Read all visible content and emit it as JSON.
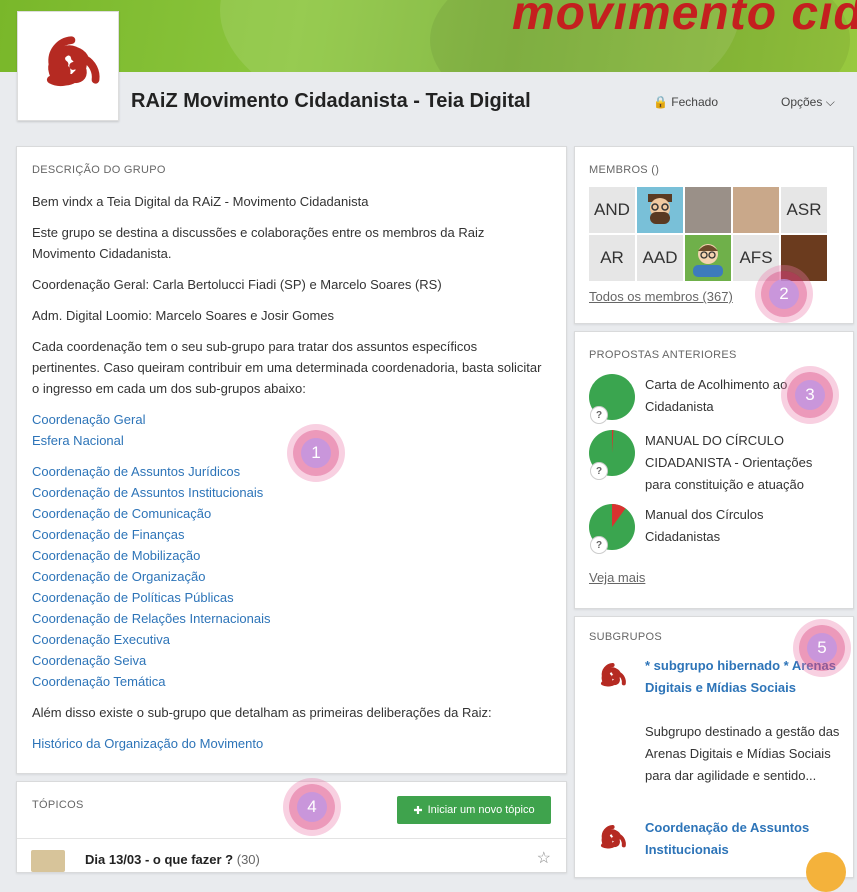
{
  "banner": {
    "text": "movimento cid"
  },
  "group": {
    "title": "RAiZ Movimento Cidadanista - Teia Digital",
    "privacy_label": "Fechado",
    "options_label": "Opções"
  },
  "description": {
    "label": "DESCRIÇÃO DO GRUPO",
    "paragraphs": [
      "Bem vindx a Teia Digital da RAiZ - Movimento Cidadanista",
      "Este grupo se destina a discussões e colaborações entre os membros da Raiz Movimento Cidadanista.",
      "Coordenação Geral: Carla Bertolucci Fiadi (SP) e Marcelo Soares (RS)",
      "Adm. Digital Loomio: Marcelo Soares e Josir Gomes",
      "Cada coordenação tem o seu sub-grupo para tratar dos assuntos específicos pertinentes. Caso queiram contribuir em uma determinada coordenadoria, basta solicitar o ingresso em cada um dos sub-grupos abaixo:"
    ],
    "links_a": [
      "Coordenação Geral",
      "Esfera Nacional"
    ],
    "links_b": [
      "Coordenação de Assuntos Jurídicos",
      "Coordenação de Assuntos Institucionais",
      "Coordenação de Comunicação",
      "Coordenação de Finanças",
      "Coordenação de Mobilização",
      "Coordenação de Organização",
      "Coordenação de Políticas Públicas",
      "Coordenação de Relações Internacionais",
      "Coordenação Executiva",
      "Coordenação Seiva",
      "Coordenação Temática"
    ],
    "closing": "Além disso existe o sub-grupo que detalham as primeiras deliberações da Raiz:",
    "history_link": "Histórico da Organização do Movimento"
  },
  "topics": {
    "label": "TÓPICOS",
    "new_button": "Iniciar um novo tópico",
    "first_topic": {
      "title": "Dia 13/03 - o que fazer ?",
      "count": "(30)"
    }
  },
  "members": {
    "label": "MEMBROS ()",
    "avatars": [
      "AND",
      "",
      "",
      "",
      "ASR",
      "AR",
      "AAD",
      "",
      "AFS",
      ""
    ],
    "all_link": "Todos os membros (367)"
  },
  "proposals": {
    "label": "PROPOSTAS ANTERIORES",
    "items": [
      {
        "title": "Carta de Acolhimento ao Cidadanista",
        "red_fraction": 0.0
      },
      {
        "title": "MANUAL DO CÍRCULO CIDADANISTA - Orientações para constituição e atuação",
        "red_fraction": 0.01
      },
      {
        "title": "Manual dos Círculos Cidadanistas",
        "red_fraction": 0.1
      }
    ],
    "unknown_mark": "?",
    "see_more": "Veja mais"
  },
  "subgroups": {
    "label": "SUBGRUPOS",
    "items": [
      {
        "name": "* subgrupo hibernado * Arenas Digitais e Mídias Sociais",
        "description": "Subgrupo destinado a gestão das Arenas Digitais e Mídias Sociais para dar agilidade e sentido..."
      },
      {
        "name": "Coordenação de Assuntos Institucionais",
        "description": ""
      }
    ]
  },
  "markers": [
    "1",
    "2",
    "3",
    "4",
    "5"
  ],
  "colors": {
    "link": "#2d74b8",
    "accent_green": "#3fa34d",
    "pie_green": "#3aa54f",
    "pie_red": "#d9322f",
    "marker_pink": "#dc4682",
    "brand_red": "#b52a22"
  }
}
